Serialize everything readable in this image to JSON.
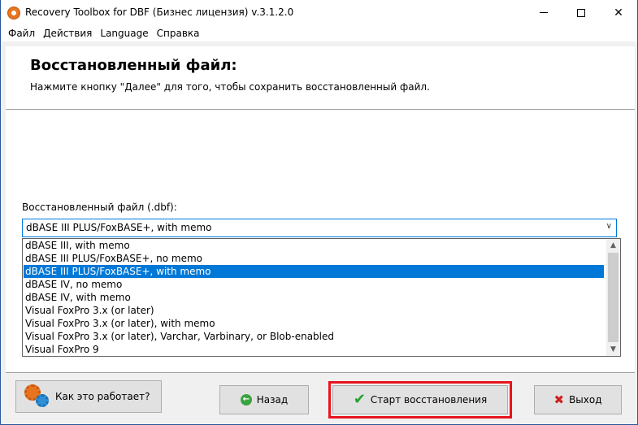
{
  "window": {
    "title": "Recovery Toolbox for DBF (Бизнес лицензия) v.3.1.2.0",
    "controls": {
      "minimize": "—",
      "maximize": "☐",
      "close": "✕"
    }
  },
  "menu": [
    "Файл",
    "Действия",
    "Language",
    "Справка"
  ],
  "header": {
    "title": "Восстановленный файл:",
    "description": "Нажмите кнопку \"Далее\" для того, чтобы сохранить восстановленный файл."
  },
  "format": {
    "label": "Восстановленный файл (.dbf):",
    "selected": "dBASE III PLUS/FoxBASE+, with memo",
    "options": [
      "dBASE III, with memo",
      "dBASE III PLUS/FoxBASE+, no memo",
      "dBASE III PLUS/FoxBASE+, with memo",
      "dBASE IV, no memo",
      "dBASE IV, with memo",
      "Visual FoxPro 3.x (or later)",
      "Visual FoxPro 3.x (or later), with memo",
      "Visual FoxPro 3.x (or later), Varchar, Varbinary, or Blob-enabled",
      "Visual FoxPro 9"
    ],
    "selected_index": 2
  },
  "buttons": {
    "how": "Как это работает?",
    "back": "Назад",
    "start": "Старт восстановления",
    "exit": "Выход"
  },
  "colors": {
    "selection": "#0078d7",
    "highlight_frame": "#e8141e",
    "title_bar": "#ffffff"
  }
}
